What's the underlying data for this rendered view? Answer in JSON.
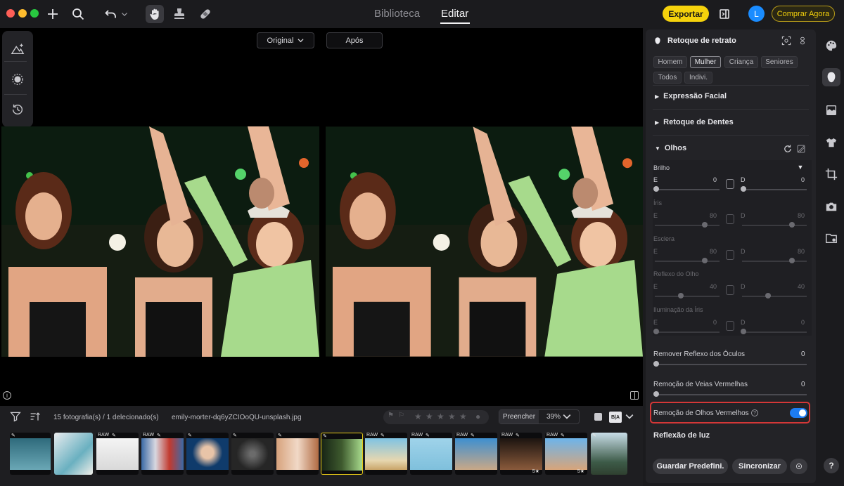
{
  "header": {
    "tabs": [
      {
        "label": "Biblioteca"
      },
      {
        "label": "Editar"
      }
    ],
    "export_label": "Exportar",
    "avatar_initial": "L",
    "buy_label": "Comprar Agora"
  },
  "compare": {
    "original_label": "Original",
    "after_label": "Após"
  },
  "filmstrip": {
    "count_text": "15 fotografia(s) / 1 delecionado(s)",
    "filename": "emily-morter-dq6yZCIOoQU-unsplash.jpg",
    "fill_label": "Preencher",
    "zoom_label": "39%",
    "view_toggle": "B|A",
    "thumbs": [
      {
        "raw": "",
        "pen": "✎",
        "stars": ""
      },
      {
        "raw": "",
        "pen": "✎",
        "stars": ""
      },
      {
        "raw": "RAW",
        "pen": "✎",
        "stars": ""
      },
      {
        "raw": "RAW",
        "pen": "✎",
        "stars": ""
      },
      {
        "raw": "",
        "pen": "✎",
        "stars": ""
      },
      {
        "raw": "",
        "pen": "✎",
        "stars": ""
      },
      {
        "raw": "",
        "pen": "✎",
        "stars": ""
      },
      {
        "raw": "",
        "pen": "✎",
        "stars": ""
      },
      {
        "raw": "RAW",
        "pen": "✎",
        "stars": ""
      },
      {
        "raw": "RAW",
        "pen": "✎",
        "stars": ""
      },
      {
        "raw": "RAW",
        "pen": "✎",
        "stars": ""
      },
      {
        "raw": "RAW",
        "pen": "✎",
        "stars": "5★"
      },
      {
        "raw": "RAW",
        "pen": "✎",
        "stars": "5★"
      },
      {
        "raw": "",
        "pen": "✎",
        "stars": ""
      }
    ]
  },
  "panel": {
    "title": "Retoque de retrato",
    "chips": [
      "Homem",
      "Mulher",
      "Criança",
      "Seniores",
      "Todos",
      "Indivi."
    ],
    "sections": {
      "facial": "Expressão Facial",
      "teeth": "Retoque de Dentes",
      "eyes": "Olhos"
    },
    "eyes": {
      "rows": [
        {
          "label": "Brilho",
          "left_tag": "E",
          "left_value": "0",
          "right_tag": "D",
          "right_value": "0"
        },
        {
          "label": "Íris",
          "left_tag": "E",
          "left_value": "80",
          "right_tag": "D",
          "right_value": "80"
        },
        {
          "label": "Esclera",
          "left_tag": "E",
          "left_value": "80",
          "right_tag": "D",
          "right_value": "80"
        },
        {
          "label": "Reflexo do Olho",
          "left_tag": "E",
          "left_value": "40",
          "right_tag": "D",
          "right_value": "40"
        },
        {
          "label": "Iluminação da Íris",
          "left_tag": "E",
          "left_value": "0",
          "right_tag": "D",
          "right_value": "0"
        }
      ]
    },
    "glasses": {
      "label": "Remover Reflexo dos Óculos",
      "value": "0"
    },
    "veins": {
      "label": "Remoção de Veias Vermelhas",
      "value": "0"
    },
    "red_eye": {
      "label": "Remoção de Olhos Vermelhos",
      "enabled": true
    },
    "light_reflection": "Reflexão de luz",
    "save_preset": "Guardar Predefini.",
    "sync": "Sincronizar"
  },
  "help_label": "?"
}
